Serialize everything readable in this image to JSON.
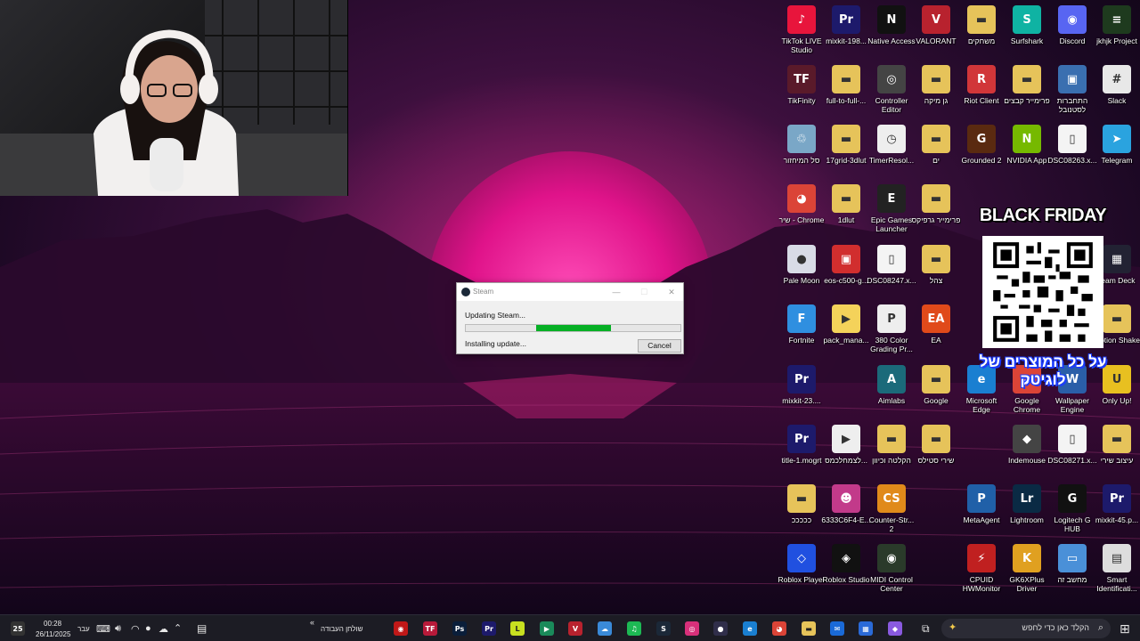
{
  "webcam": {
    "label": ""
  },
  "steam_dialog": {
    "title": "Steam",
    "status": "Updating Steam...",
    "progress": 0.5,
    "sub_status": "Installing update...",
    "cancel_label": "Cancel"
  },
  "promo": {
    "title": "BLACK FRIDAY",
    "subtitle": "על כל המוצרים של לוגיטק"
  },
  "desktop_icons": [
    {
      "id": "tiktok-live",
      "label": "TikTok LIVE Studio",
      "glyph": "♪",
      "color": "#e8153c"
    },
    {
      "id": "mixkit-198",
      "label": "mixkit-198...",
      "glyph": "Pr",
      "color": "#1d1a6b"
    },
    {
      "id": "native-access",
      "label": "Native Access",
      "glyph": "N",
      "color": "#111111"
    },
    {
      "id": "valorant",
      "label": "VALORANT",
      "glyph": "V",
      "color": "#b8222e"
    },
    {
      "id": "games-folder",
      "label": "משחקים",
      "glyph": "▬",
      "color": "#e6c35a"
    },
    {
      "id": "surfshark",
      "label": "Surfshark",
      "glyph": "S",
      "color": "#0fb3a3"
    },
    {
      "id": "discord",
      "label": "Discord",
      "glyph": "◉",
      "color": "#5865f2"
    },
    {
      "id": "jkhjk",
      "label": "jkhjk Project",
      "glyph": "≡",
      "color": "#1e3a1e"
    },
    {
      "id": "tikfinity",
      "label": "TikFinity",
      "glyph": "TF",
      "color": "#5a1a2a"
    },
    {
      "id": "full-to-full",
      "label": "full-to-full-...",
      "glyph": "▬",
      "color": "#e6c35a"
    },
    {
      "id": "controller-editor",
      "label": "Controller Editor",
      "glyph": "◎",
      "color": "#444444"
    },
    {
      "id": "gan-miki",
      "label": "גן מיקה",
      "glyph": "▬",
      "color": "#e6c35a"
    },
    {
      "id": "riot-client",
      "label": "Riot Client",
      "glyph": "R",
      "color": "#d13639"
    },
    {
      "id": "premiere-files",
      "label": "פרימייר קבצים",
      "glyph": "▬",
      "color": "#e6c35a"
    },
    {
      "id": "hitchabrut",
      "label": "התחברות לסטנובל",
      "glyph": "▣",
      "color": "#3a6fb0"
    },
    {
      "id": "slack",
      "label": "Slack",
      "glyph": "#",
      "color": "#e8e8e8"
    },
    {
      "id": "recycle",
      "label": "סל המיחזור",
      "glyph": "♲",
      "color": "#7aa7c7"
    },
    {
      "id": "17grid",
      "label": "17grid-3dlut",
      "glyph": "▬",
      "color": "#e6c35a"
    },
    {
      "id": "timer-resol",
      "label": "TimerResol...",
      "glyph": "◷",
      "color": "#eeeeee"
    },
    {
      "id": "yam",
      "label": "ים",
      "glyph": "▬",
      "color": "#e6c35a"
    },
    {
      "id": "grounded2",
      "label": "Grounded 2",
      "glyph": "G",
      "color": "#5a2a10"
    },
    {
      "id": "nvidia",
      "label": "NVIDIA App",
      "glyph": "N",
      "color": "#76b900"
    },
    {
      "id": "dsc08263",
      "label": "DSC08263.x...",
      "glyph": "▯",
      "color": "#f4f4f4"
    },
    {
      "id": "telegram",
      "label": "Telegram",
      "glyph": "➤",
      "color": "#2aa3df"
    },
    {
      "id": "chrome-shir",
      "label": "שיר - Chrome",
      "glyph": "◕",
      "color": "#db4437"
    },
    {
      "id": "1dlut",
      "label": "1dlut",
      "glyph": "▬",
      "color": "#e6c35a"
    },
    {
      "id": "epic",
      "label": "Epic Games Launcher",
      "glyph": "E",
      "color": "#222222"
    },
    {
      "id": "premiere-graphics",
      "label": "פרימייר גרפיקס",
      "glyph": "▬",
      "color": "#e6c35a"
    },
    {
      "id": "pale-moon",
      "label": "Pale Moon",
      "glyph": "●",
      "color": "#d8dbe6"
    },
    {
      "id": "eos-c500",
      "label": "eos-c500-g...",
      "glyph": "▣",
      "color": "#d12e2e"
    },
    {
      "id": "dsc08247",
      "label": "DSC08247.x...",
      "glyph": "▯",
      "color": "#f4f4f4"
    },
    {
      "id": "tzahal",
      "label": "צהל",
      "glyph": "▬",
      "color": "#e6c35a"
    },
    {
      "id": "stream-deck",
      "label": "ream Deck",
      "glyph": "▦",
      "color": "#222233"
    },
    {
      "id": "fortnite",
      "label": "Fortnite",
      "glyph": "F",
      "color": "#2f8fe0"
    },
    {
      "id": "pack-mana",
      "label": "pack_mana...",
      "glyph": "▶",
      "color": "#f4d25a"
    },
    {
      "id": "380-color",
      "label": "380 Color Grading Pr...",
      "glyph": "P",
      "color": "#eeeeee"
    },
    {
      "id": "ea",
      "label": "EA",
      "glyph": "EA",
      "color": "#e04a1a"
    },
    {
      "id": "motion-shake",
      "label": "Motion Shake",
      "glyph": "▬",
      "color": "#e6c35a"
    },
    {
      "id": "mixkit-23",
      "label": "mixkit-23....",
      "glyph": "Pr",
      "color": "#1d1a6b"
    },
    {
      "id": "aimlabs",
      "label": "Aimlabs",
      "glyph": "A",
      "color": "#1b6a7a"
    },
    {
      "id": "google",
      "label": "Google",
      "glyph": "▬",
      "color": "#e6c35a"
    },
    {
      "id": "edge",
      "label": "Microsoft Edge",
      "glyph": "e",
      "color": "#1a7fd1"
    },
    {
      "id": "google-chrome",
      "label": "Google Chrome",
      "glyph": "◕",
      "color": "#db4437"
    },
    {
      "id": "wallpaper-engine",
      "label": "Wallpaper Engine",
      "glyph": "W",
      "color": "#2a5ea8"
    },
    {
      "id": "only-up",
      "label": "Only Up!",
      "glyph": "U",
      "color": "#e8c020"
    },
    {
      "id": "title-1",
      "label": "title-1.mogrt",
      "glyph": "Pr",
      "color": "#1d1a6b"
    },
    {
      "id": "lnkmachasheva",
      "label": "לצמחלכמס...",
      "glyph": "▶",
      "color": "#eeeeee"
    },
    {
      "id": "haklata",
      "label": "הקלטה וכיוון",
      "glyph": "▬",
      "color": "#e6c35a"
    },
    {
      "id": "shirei-stills",
      "label": "שירי סטילס",
      "glyph": "▬",
      "color": "#e6c35a"
    },
    {
      "id": "indemouse",
      "label": "Indemouse",
      "glyph": "◆",
      "color": "#444444"
    },
    {
      "id": "dsc08271",
      "label": "DSC08271.x...",
      "glyph": "▯",
      "color": "#f4f4f4"
    },
    {
      "id": "itzuv-shiri",
      "label": "עיצוב שירי",
      "glyph": "▬",
      "color": "#e6c35a"
    },
    {
      "id": "cccccc",
      "label": "כככככ",
      "glyph": "▬",
      "color": "#e6c35a"
    },
    {
      "id": "6333c6f4",
      "label": "6333C6F4-E...",
      "glyph": "☻",
      "color": "#c23a8a"
    },
    {
      "id": "counter-strike",
      "label": "Counter-Str... 2",
      "glyph": "CS",
      "color": "#e08a1a"
    },
    {
      "id": "metaagent",
      "label": "MetaAgent",
      "glyph": "P",
      "color": "#2060a8"
    },
    {
      "id": "lightroom",
      "label": "Lightroom",
      "glyph": "Lr",
      "color": "#0a2a44"
    },
    {
      "id": "logitech-ghub",
      "label": "Logitech G HUB",
      "glyph": "G",
      "color": "#111111"
    },
    {
      "id": "mixkit-45",
      "label": "mixkit-45.p...",
      "glyph": "Pr",
      "color": "#1d1a6b"
    },
    {
      "id": "roblox-player",
      "label": "Roblox Player",
      "glyph": "◇",
      "color": "#2050e0"
    },
    {
      "id": "roblox-studio",
      "label": "Roblox Studio",
      "glyph": "◈",
      "color": "#111111"
    },
    {
      "id": "midi-control",
      "label": "MIDI Control Center",
      "glyph": "◉",
      "color": "#2a3a2a"
    },
    {
      "id": "cpuid",
      "label": "CPUID HWMonitor",
      "glyph": "⚡",
      "color": "#c02020"
    },
    {
      "id": "gk6xplus",
      "label": "GK6XPlus Driver",
      "glyph": "K",
      "color": "#e0a020"
    },
    {
      "id": "machshev-ze",
      "label": "מחשב זה",
      "glyph": "▭",
      "color": "#4a90d8"
    },
    {
      "id": "smart-ident",
      "label": "Smart Identificati...",
      "glyph": "▤",
      "color": "#dddddd"
    }
  ],
  "taskbar": {
    "time": "00:28",
    "date": "26/11/2025",
    "lang": "עבר",
    "desktop_label": "שולחן העבודה",
    "search_placeholder": "הקלד כאן כדי לחפש",
    "notif_count": "25",
    "apps": [
      {
        "id": "app-red",
        "glyph": "◉",
        "color": "#c01818"
      },
      {
        "id": "app-tikfinity",
        "glyph": "TF",
        "color": "#b81a3a"
      },
      {
        "id": "app-photoshop",
        "glyph": "Ps",
        "color": "#0a1e3a"
      },
      {
        "id": "app-premiere",
        "glyph": "Pr",
        "color": "#1d1a6b"
      },
      {
        "id": "app-live",
        "glyph": "L",
        "color": "#c8e020"
      },
      {
        "id": "app-green",
        "glyph": "▶",
        "color": "#1a8a5a"
      },
      {
        "id": "app-valorant",
        "glyph": "V",
        "color": "#b8222e"
      },
      {
        "id": "app-cloud",
        "glyph": "☁",
        "color": "#3a8ad8"
      },
      {
        "id": "app-spotify",
        "glyph": "♫",
        "color": "#1db954"
      },
      {
        "id": "app-steam",
        "glyph": "S",
        "color": "#1b2838"
      },
      {
        "id": "app-instagram",
        "glyph": "◎",
        "color": "#d8307a"
      },
      {
        "id": "app-obs",
        "glyph": "●",
        "color": "#302e4a"
      },
      {
        "id": "app-edge",
        "glyph": "e",
        "color": "#1a7fd1"
      },
      {
        "id": "app-chrome",
        "glyph": "◕",
        "color": "#db4437"
      },
      {
        "id": "app-explorer",
        "glyph": "▬",
        "color": "#e6c35a"
      },
      {
        "id": "app-mail",
        "glyph": "✉",
        "color": "#1a6ad8"
      },
      {
        "id": "app-store",
        "glyph": "▦",
        "color": "#2a6ad8"
      },
      {
        "id": "app-copilot",
        "glyph": "◆",
        "color": "#8a5ae0"
      }
    ]
  }
}
